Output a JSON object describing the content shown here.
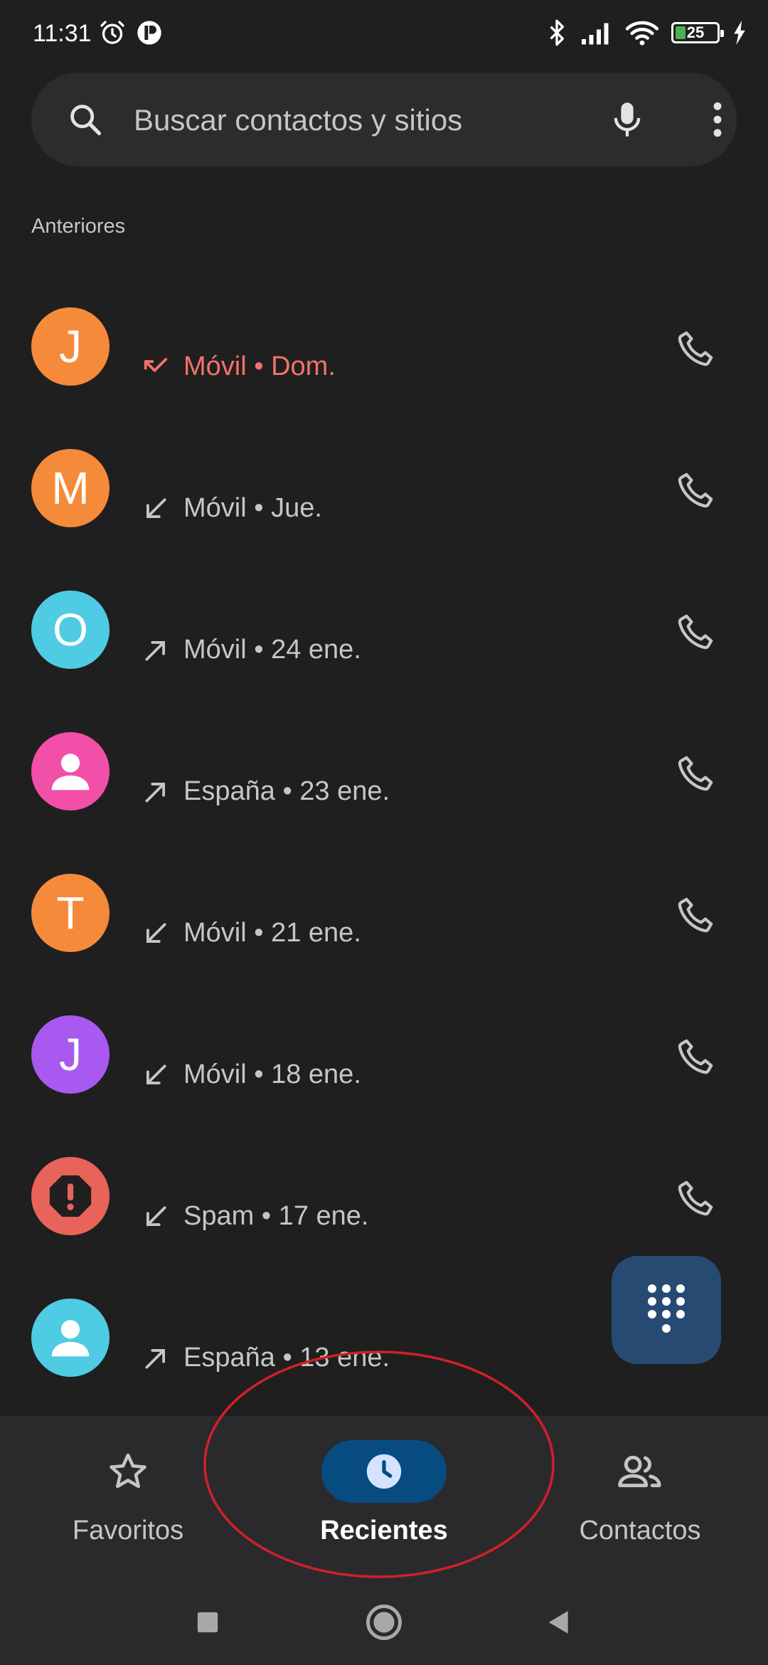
{
  "status_bar": {
    "time": "11:31",
    "battery_level": "25"
  },
  "search": {
    "placeholder": "Buscar contactos y sitios"
  },
  "section_label": "Anteriores",
  "calls": [
    {
      "initial": "J",
      "avatar_color": "#f58a3b",
      "type": "missed",
      "type_icon": "missed-call-icon",
      "detail": "Móvil • Dom."
    },
    {
      "initial": "M",
      "avatar_color": "#f58a3b",
      "type": "incoming",
      "type_icon": "incoming-call-icon",
      "detail": "Móvil • Jue."
    },
    {
      "initial": "O",
      "avatar_color": "#4fcbe3",
      "type": "outgoing",
      "type_icon": "outgoing-call-icon",
      "detail": "Móvil • 24 ene."
    },
    {
      "initial": "",
      "avatar_color": "#f24fa9",
      "type": "outgoing",
      "type_icon": "outgoing-call-icon",
      "detail": "España • 23 ene."
    },
    {
      "initial": "T",
      "avatar_color": "#f58a3b",
      "type": "incoming",
      "type_icon": "incoming-call-icon",
      "detail": "Móvil • 21 ene."
    },
    {
      "initial": "J",
      "avatar_color": "#a859f0",
      "type": "incoming",
      "type_icon": "incoming-call-icon",
      "detail": "Móvil • 18 ene."
    },
    {
      "initial": "",
      "avatar_color": "#e8645a",
      "type": "incoming",
      "type_icon": "incoming-call-icon",
      "detail": "Spam • 17 ene."
    },
    {
      "initial": "",
      "avatar_color": "#4fcbe3",
      "type": "outgoing",
      "type_icon": "outgoing-call-icon",
      "detail": "España • 13 ene."
    }
  ],
  "bottom_nav": {
    "items": [
      {
        "label": "Favoritos",
        "icon": "star-icon",
        "active": false
      },
      {
        "label": "Recientes",
        "icon": "clock-icon",
        "active": true
      },
      {
        "label": "Contactos",
        "icon": "people-icon",
        "active": false
      }
    ]
  },
  "colors": {
    "background": "#1f1f1f",
    "search_bar": "#2b2c2e",
    "missed": "#f2726a",
    "fab": "#274a73",
    "nav_active": "#064c80",
    "annotation": "#d0202a"
  }
}
